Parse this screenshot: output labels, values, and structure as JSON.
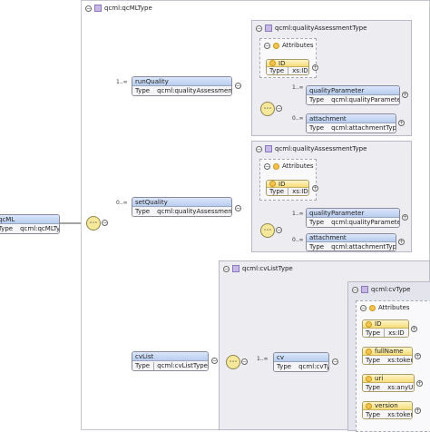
{
  "type_label": "Type",
  "root": {
    "name": "qcML",
    "type": "qcml:qcMLType"
  },
  "outer_frame": {
    "title": "qcml:qcMLType"
  },
  "run_quality": {
    "name": "runQuality",
    "type": "qcml:qualityAssessmentType",
    "multiplicity": "1..∞"
  },
  "set_quality": {
    "name": "setQuality",
    "type": "qcml:qualityAssessmentType",
    "multiplicity": "0..∞"
  },
  "cv_list": {
    "name": "cvList",
    "type": "qcml:cvListType"
  },
  "qa_frame": {
    "title": "qcml:qualityAssessmentType",
    "attributes_label": "Attributes",
    "id_attr": {
      "name": "ID",
      "type": "xs:ID"
    },
    "quality_parameter": {
      "name": "qualityParameter",
      "type": "qcml:qualityParameterType",
      "multiplicity": "1..∞"
    },
    "attachment": {
      "name": "attachment",
      "type": "qcml:attachmentType",
      "multiplicity": "0..∞"
    }
  },
  "cvlist_frame": {
    "title": "qcml:cvListType"
  },
  "cv": {
    "name": "cv",
    "type": "qcml:cvType",
    "multiplicity": "1..∞"
  },
  "cv_frame": {
    "title": "qcml:cvType",
    "attributes_label": "Attributes",
    "attrs": [
      {
        "name": "ID",
        "type": "xs:ID"
      },
      {
        "name": "fullName",
        "type": "xs:token"
      },
      {
        "name": "uri",
        "type": "xs:anyURI"
      },
      {
        "name": "version",
        "type": "xs:token"
      }
    ]
  },
  "icons": {
    "collapse": "minus-circle-icon",
    "type": "complex-type-icon",
    "attribute": "attribute-icon",
    "sequence": "sequence-compositor-icon"
  },
  "colors": {
    "frame_bg": "#ececf1",
    "element_header": "#b8cdee",
    "attribute_header": "#f5dd7a",
    "compositor": "#f5e89a"
  }
}
